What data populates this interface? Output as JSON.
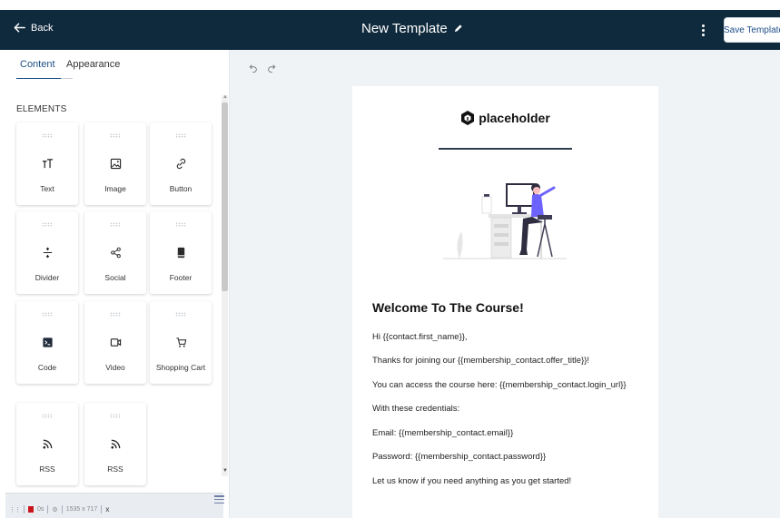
{
  "topbar": {
    "back_label": "Back",
    "title": "New Template",
    "save_label": "Save Template"
  },
  "left_panel": {
    "tabs": [
      {
        "label": "Content",
        "active": true
      },
      {
        "label": "Appearance",
        "active": false
      }
    ],
    "section_label": "ELEMENTS",
    "elements": [
      {
        "label": "Text",
        "icon": "text-icon"
      },
      {
        "label": "Image",
        "icon": "image-icon"
      },
      {
        "label": "Button",
        "icon": "link-icon"
      },
      {
        "label": "Divider",
        "icon": "divider-icon"
      },
      {
        "label": "Social",
        "icon": "share-icon"
      },
      {
        "label": "Footer",
        "icon": "footer-icon"
      },
      {
        "label": "Code",
        "icon": "code-icon"
      },
      {
        "label": "Video",
        "icon": "video-icon"
      },
      {
        "label": "Shopping Cart",
        "icon": "cart-icon"
      },
      {
        "label": "RSS",
        "icon": "rss-icon"
      },
      {
        "label": "RSS",
        "icon": "rss-icon"
      }
    ]
  },
  "statusbar": {
    "time": "0s",
    "size": "1535 x 717",
    "close": "x"
  },
  "email": {
    "logo_text": "placeholder",
    "heading": "Welcome To The Course!",
    "lines": [
      "Hi {{contact.first_name}},",
      "Thanks for joining our {{membership_contact.offer_title}}!",
      "You can access the course here: {{membership_contact.login_url}}",
      "With these credentials:",
      "Email: {{membership_contact.email}}",
      "Password: {{membership_contact.password}}",
      "Let us know if you need anything as you get started!"
    ]
  },
  "colors": {
    "topbar": "#102a3d",
    "accent": "#1e4f86",
    "canvas_bg": "#f0f3f6",
    "illustration_accent": "#6c63ff"
  }
}
